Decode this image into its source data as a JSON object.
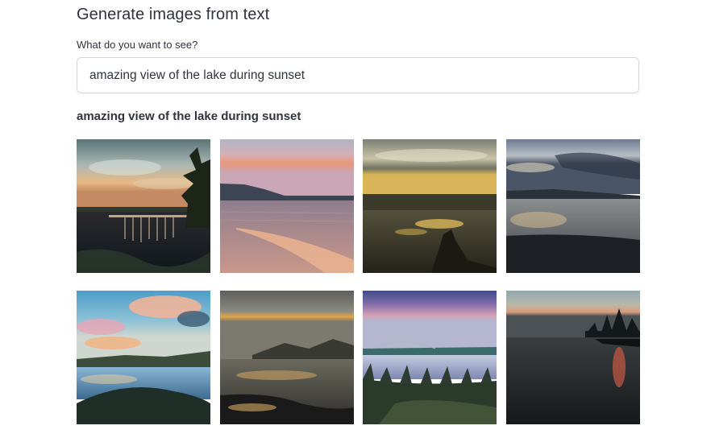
{
  "page": {
    "title": "Generate images from text"
  },
  "prompt": {
    "label": "What do you want to see?",
    "value": "amazing view of the lake during sunset"
  },
  "results": {
    "heading": "amazing view of the lake during sunset",
    "images": [
      {
        "subject": "lake sunset with dock and tree silhouette"
      },
      {
        "subject": "pink sunset over calm lake with shore"
      },
      {
        "subject": "golden sunset over lake with silhouette"
      },
      {
        "subject": "cloudy sky over lake with dark shoreline"
      },
      {
        "subject": "blue sky with pink clouds over lake"
      },
      {
        "subject": "dusk over lake with mountain"
      },
      {
        "subject": "purple sky over lake with bare trees"
      },
      {
        "subject": "dark lake at dusk with tree island"
      }
    ]
  }
}
